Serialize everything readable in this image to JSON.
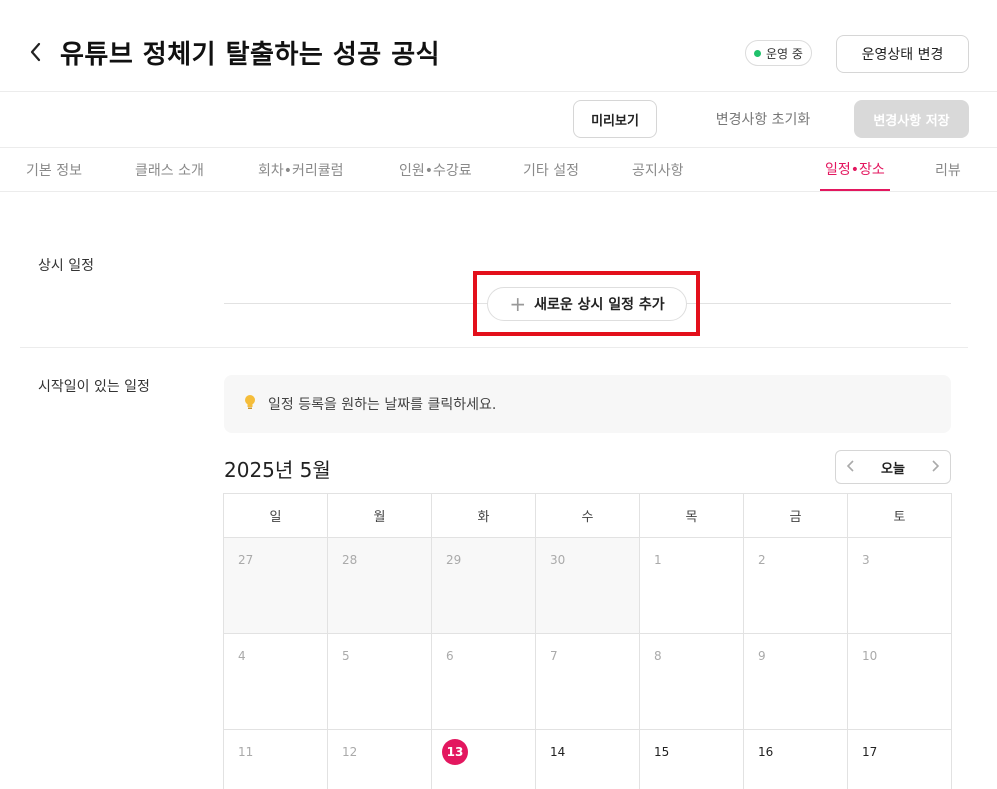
{
  "header": {
    "title": "유튜브 정체기 탈출하는 성공 공식",
    "status_badge": "운영 중",
    "status_change_label": "운영상태 변경"
  },
  "actions": {
    "preview_label": "미리보기",
    "reset_label": "변경사항 초기화",
    "save_label": "변경사항 저장"
  },
  "tabs": [
    {
      "label": "기본 정보"
    },
    {
      "label": "클래스 소개"
    },
    {
      "label": "회차•커리큘럼"
    },
    {
      "label": "인원•수강료"
    },
    {
      "label": "기타 설정"
    },
    {
      "label": "공지사항"
    },
    {
      "label": "일정•장소",
      "active": true
    },
    {
      "label": "리뷰"
    }
  ],
  "recurring": {
    "label": "상시 일정",
    "add_button": "새로운 상시 일정 추가"
  },
  "dated": {
    "label": "시작일이 있는 일정",
    "info_text": "일정 등록을 원하는 날짜를 클릭하세요."
  },
  "calendar": {
    "month_label": "2025년 5월",
    "today_label": "오늘",
    "weekdays": [
      "일",
      "월",
      "화",
      "수",
      "목",
      "금",
      "토"
    ],
    "rows": [
      [
        "27",
        "28",
        "29",
        "30",
        "1",
        "2",
        "3"
      ],
      [
        "4",
        "5",
        "6",
        "7",
        "8",
        "9",
        "10"
      ],
      [
        "11",
        "12",
        "13",
        "14",
        "15",
        "16",
        "17"
      ]
    ],
    "today_date": "13"
  },
  "colors": {
    "accent": "#e3175f",
    "status_green": "#1fc16b",
    "highlight_red": "#e3101b"
  }
}
